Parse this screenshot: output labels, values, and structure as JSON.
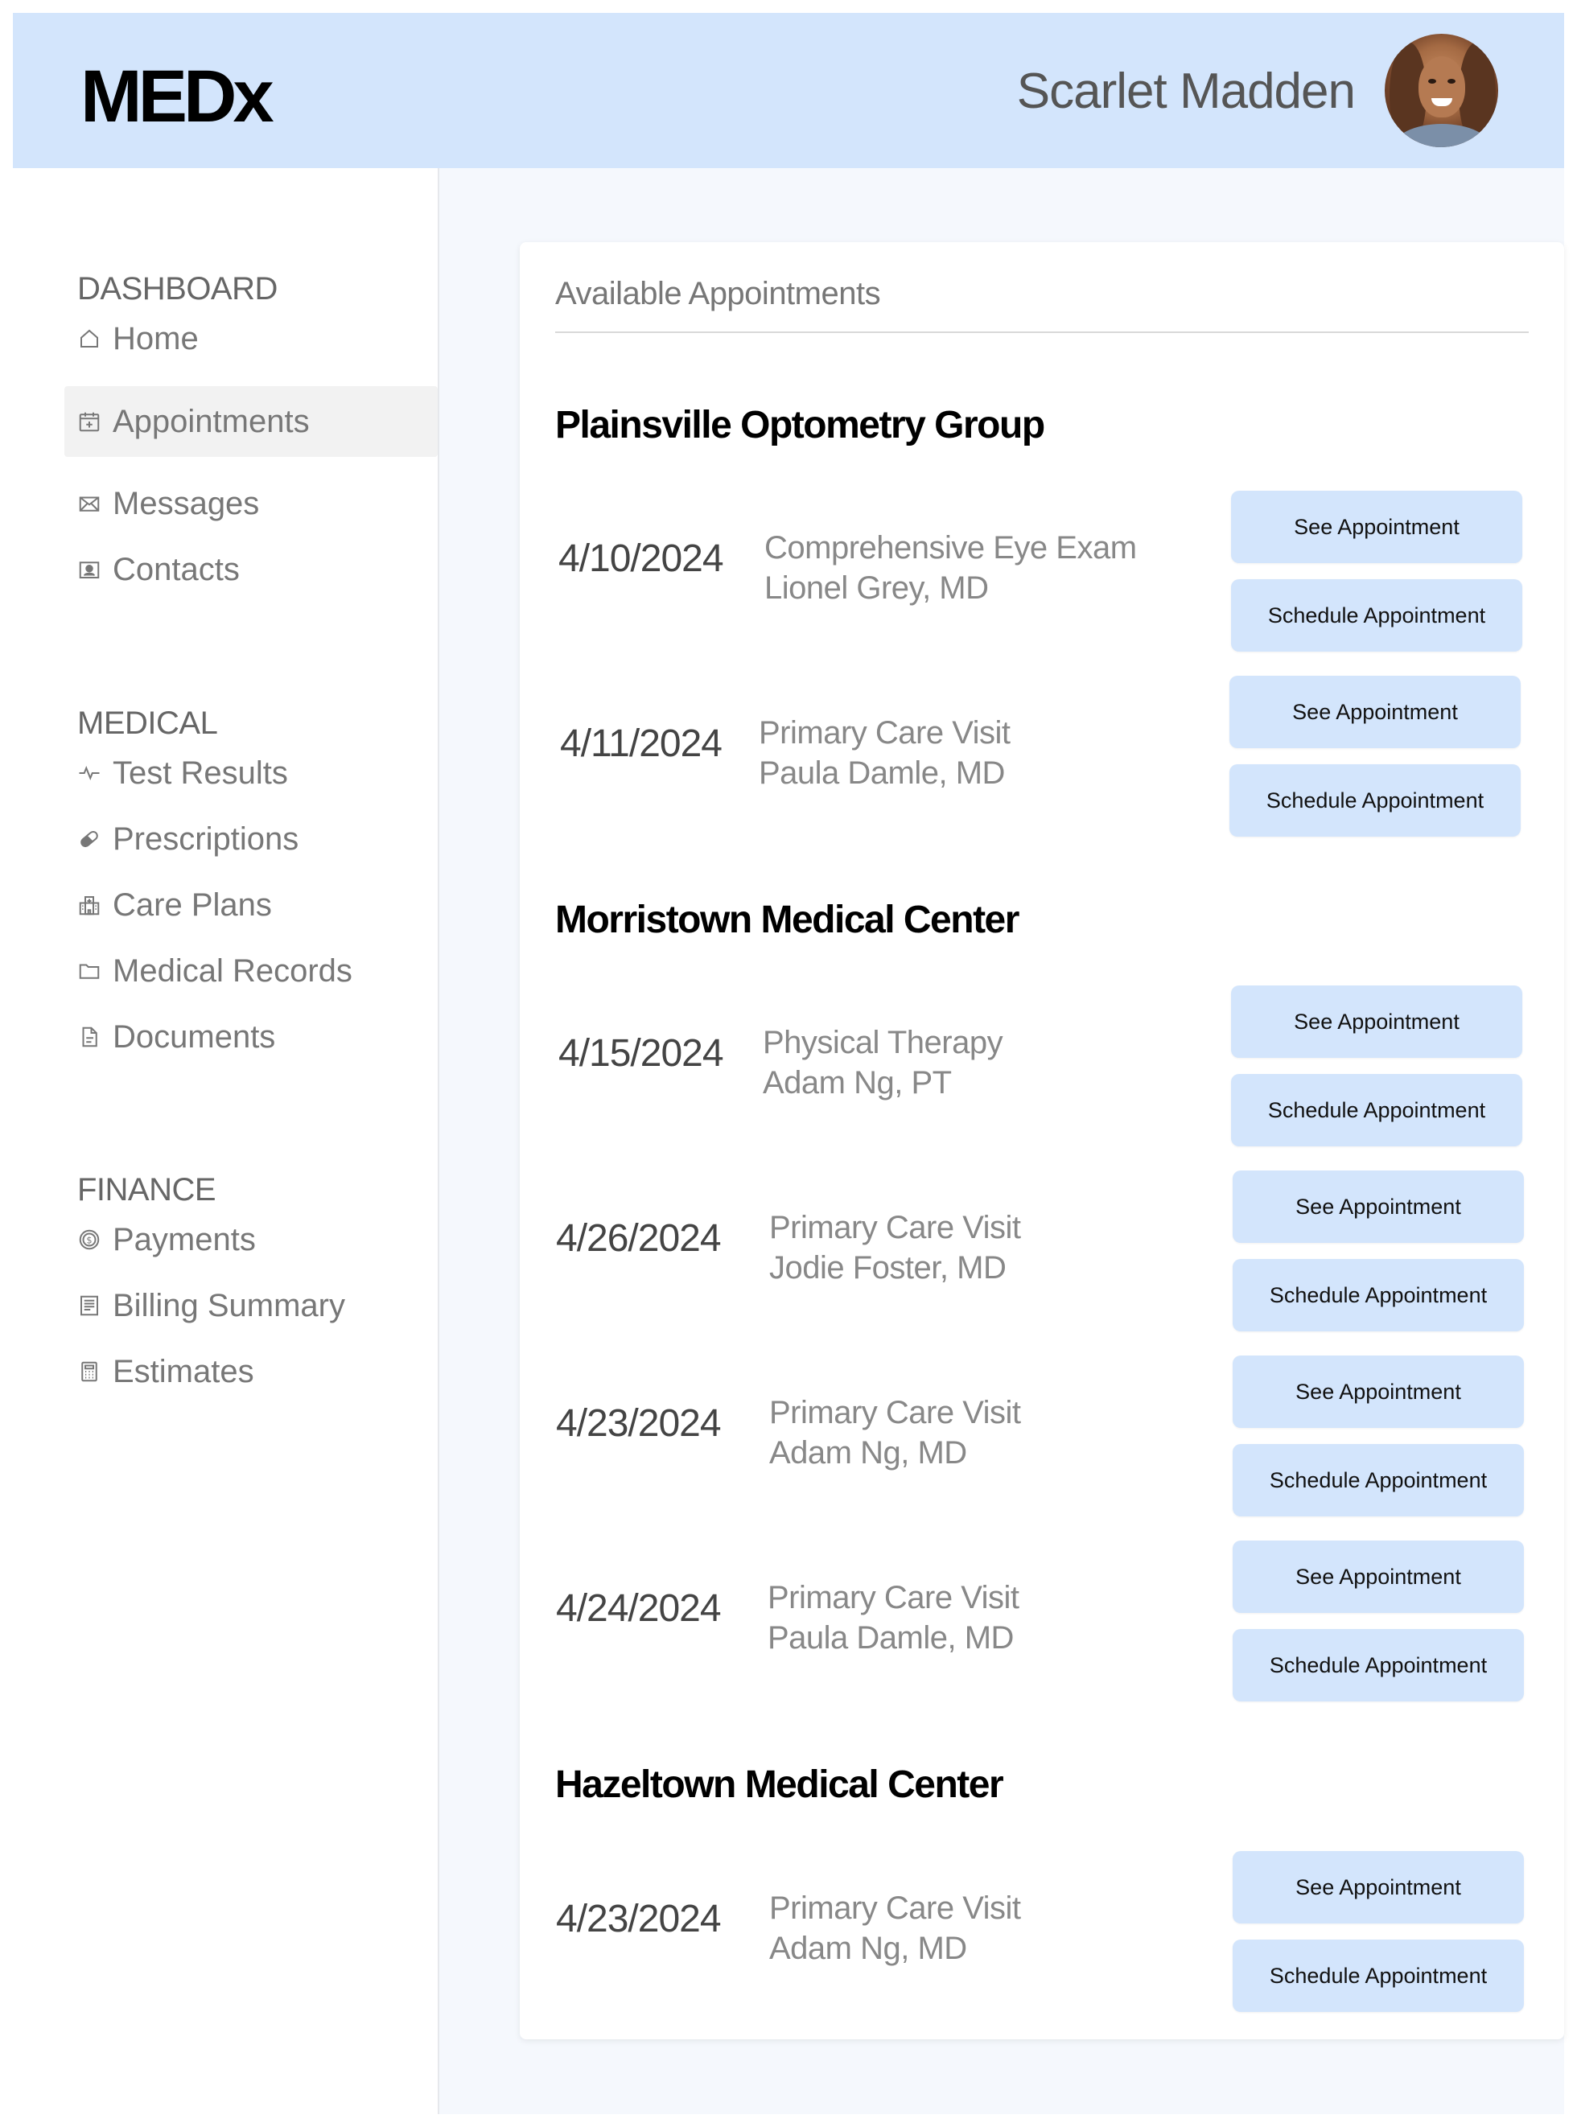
{
  "header": {
    "logo": "MEDx",
    "user_name": "Scarlet Madden"
  },
  "sidebar": {
    "sections": [
      {
        "title": "DASHBOARD",
        "items": [
          {
            "label": "Home",
            "icon": "home-icon"
          },
          {
            "label": "Appointments",
            "icon": "calendar-icon",
            "active": true
          },
          {
            "label": "Messages",
            "icon": "envelope-icon"
          },
          {
            "label": "Contacts",
            "icon": "contact-card-icon"
          }
        ]
      },
      {
        "title": "MEDICAL",
        "items": [
          {
            "label": "Test Results",
            "icon": "pulse-icon"
          },
          {
            "label": "Prescriptions",
            "icon": "pill-icon"
          },
          {
            "label": "Care Plans",
            "icon": "hospital-icon"
          },
          {
            "label": "Medical Records",
            "icon": "folder-icon"
          },
          {
            "label": "Documents",
            "icon": "document-icon"
          }
        ]
      },
      {
        "title": "FINANCE",
        "items": [
          {
            "label": "Payments",
            "icon": "dollar-circle-icon"
          },
          {
            "label": "Billing Summary",
            "icon": "receipt-icon"
          },
          {
            "label": "Estimates",
            "icon": "calculator-icon"
          }
        ]
      }
    ]
  },
  "main": {
    "card_title": "Available Appointments",
    "see_label": "See Appointment",
    "schedule_label": "Schedule Appointment",
    "groups": [
      {
        "name": "Plainsville Optometry Group",
        "appointments": [
          {
            "date": "4/10/2024",
            "type": "Comprehensive Eye Exam",
            "doctor": "Lionel Grey, MD"
          },
          {
            "date": "4/11/2024",
            "type": "Primary Care Visit",
            "doctor": "Paula Damle, MD"
          }
        ]
      },
      {
        "name": "Morristown Medical Center",
        "appointments": [
          {
            "date": "4/15/2024",
            "type": "Physical Therapy",
            "doctor": "Adam Ng, PT"
          },
          {
            "date": "4/26/2024",
            "type": "Primary Care Visit",
            "doctor": "Jodie Foster, MD"
          },
          {
            "date": "4/23/2024",
            "type": "Primary Care Visit",
            "doctor": "Adam Ng, MD"
          },
          {
            "date": "4/24/2024",
            "type": "Primary Care Visit",
            "doctor": "Paula Damle, MD"
          }
        ]
      },
      {
        "name": "Hazeltown Medical Center",
        "appointments": [
          {
            "date": "4/23/2024",
            "type": "Primary Care Visit",
            "doctor": "Adam Ng, MD"
          }
        ]
      }
    ]
  },
  "colors": {
    "header_bg": "#d3e5fc",
    "button_bg": "#d3e5fc",
    "main_bg": "#f5f8fd",
    "active_nav_bg": "#f2f2f2"
  }
}
